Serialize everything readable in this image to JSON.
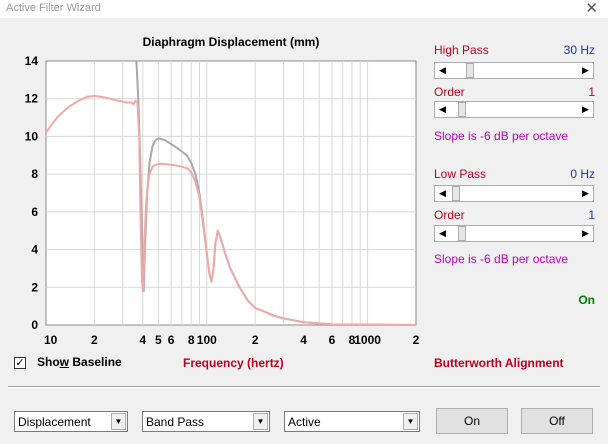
{
  "window": {
    "title": "Active Filter Wizard",
    "close_glyph": "✕"
  },
  "chart_data": {
    "type": "line",
    "title": "Diaphragm Displacement (mm)",
    "xlabel": "Frequency (hertz)",
    "x_scale": "log",
    "xlim": [
      10,
      2000
    ],
    "ylim": [
      0,
      14
    ],
    "grid": true,
    "x_tick_labels": [
      {
        "value": 10,
        "label": "10"
      },
      {
        "value": 20,
        "label": "2"
      },
      {
        "value": 40,
        "label": "4"
      },
      {
        "value": 50,
        "label": "5"
      },
      {
        "value": 60,
        "label": "6"
      },
      {
        "value": 80,
        "label": "8"
      },
      {
        "value": 100,
        "label": "100"
      },
      {
        "value": 200,
        "label": "2"
      },
      {
        "value": 400,
        "label": "4"
      },
      {
        "value": 600,
        "label": "6"
      },
      {
        "value": 800,
        "label": "8"
      },
      {
        "value": 1000,
        "label": "1000"
      },
      {
        "value": 2000,
        "label": "2"
      }
    ],
    "y_ticks": [
      0,
      2,
      4,
      6,
      8,
      10,
      12,
      14
    ],
    "series": [
      {
        "color": "#a8a8a8",
        "points": [
          [
            36.5,
            14
          ],
          [
            37.5,
            12
          ],
          [
            38.5,
            9
          ],
          [
            39.5,
            5
          ],
          [
            40,
            2
          ],
          [
            40.5,
            1.8
          ],
          [
            41.2,
            4
          ],
          [
            42.5,
            6.8
          ],
          [
            44,
            8.6
          ],
          [
            46,
            9.5
          ],
          [
            48,
            9.8
          ],
          [
            50,
            9.9
          ],
          [
            55,
            9.8
          ],
          [
            60,
            9.6
          ],
          [
            65,
            9.4
          ],
          [
            70,
            9.2
          ],
          [
            75,
            9.0
          ],
          [
            80,
            8.6
          ],
          [
            85,
            8.0
          ],
          [
            90,
            7.0
          ],
          [
            95,
            5.5
          ],
          [
            100,
            3.8
          ],
          [
            104,
            2.7
          ],
          [
            107,
            2.3
          ],
          [
            110,
            3.0
          ],
          [
            113,
            4.3
          ],
          [
            117,
            5.0
          ],
          [
            122,
            4.6
          ],
          [
            130,
            3.8
          ],
          [
            140,
            3.0
          ],
          [
            160,
            2.0
          ],
          [
            180,
            1.3
          ],
          [
            200,
            0.9
          ],
          [
            230,
            0.7
          ],
          [
            260,
            0.5
          ],
          [
            300,
            0.35
          ],
          [
            400,
            0.15
          ],
          [
            600,
            0.03
          ],
          [
            2000,
            0
          ]
        ]
      },
      {
        "color": "#f0a8a8",
        "points": [
          [
            10,
            10.2
          ],
          [
            11,
            10.7
          ],
          [
            12,
            11.1
          ],
          [
            14,
            11.6
          ],
          [
            16,
            11.9
          ],
          [
            18,
            12.1
          ],
          [
            20,
            12.15
          ],
          [
            22,
            12.1
          ],
          [
            25,
            12.0
          ],
          [
            28,
            11.9
          ],
          [
            32,
            11.8
          ],
          [
            34,
            11.8
          ],
          [
            35,
            11.7
          ],
          [
            36,
            11.9
          ],
          [
            37,
            11.8
          ],
          [
            38,
            10
          ],
          [
            38.5,
            7
          ],
          [
            39,
            4.5
          ],
          [
            39.5,
            2.5
          ],
          [
            40,
            1.8
          ],
          [
            40.5,
            2.5
          ],
          [
            41,
            4.5
          ],
          [
            42,
            6.5
          ],
          [
            43,
            7.5
          ],
          [
            44,
            8.0
          ],
          [
            46,
            8.4
          ],
          [
            48,
            8.5
          ],
          [
            52,
            8.55
          ],
          [
            60,
            8.5
          ],
          [
            70,
            8.4
          ],
          [
            76,
            8.3
          ],
          [
            80,
            8.1
          ],
          [
            85,
            7.6
          ],
          [
            90,
            6.8
          ],
          [
            95,
            5.3
          ],
          [
            100,
            3.8
          ],
          [
            104,
            2.7
          ],
          [
            107,
            2.3
          ],
          [
            110,
            3.0
          ],
          [
            113,
            4.3
          ],
          [
            117,
            5.0
          ],
          [
            122,
            4.6
          ],
          [
            130,
            3.8
          ],
          [
            140,
            3.0
          ],
          [
            160,
            2.0
          ],
          [
            180,
            1.3
          ],
          [
            200,
            0.9
          ],
          [
            230,
            0.7
          ],
          [
            260,
            0.5
          ],
          [
            300,
            0.35
          ],
          [
            400,
            0.15
          ],
          [
            600,
            0.03
          ],
          [
            2000,
            0
          ]
        ]
      }
    ]
  },
  "high_pass": {
    "label": "High Pass",
    "value": "30 Hz",
    "order_label": "Order",
    "order_value": "1",
    "slope_text": "Slope is -6 dB per octave",
    "freq_position": 0.12,
    "order_position": 0.05
  },
  "low_pass": {
    "label": "Low Pass",
    "value": "0 Hz",
    "order_label": "Order",
    "order_value": "1",
    "slope_text": "Slope is -6 dB per octave",
    "freq_position": 0.0,
    "order_position": 0.05
  },
  "status_text": "On",
  "show_baseline": {
    "label_prefix": "Sho",
    "label_mnemonic": "w",
    "label_suffix": " Baseline",
    "checked": true
  },
  "frequency_label": "Frequency (hertz)",
  "alignment_label": "Butterworth Alignment",
  "bottom": {
    "combo_plot": "Displacement",
    "combo_filter": "Band Pass",
    "combo_mode": "Active",
    "on_button": "On",
    "off_button": "Off"
  },
  "colors": {
    "red": "#c0001a",
    "blue": "#1c35b0",
    "magenta": "#c000c0",
    "green": "#008000"
  }
}
